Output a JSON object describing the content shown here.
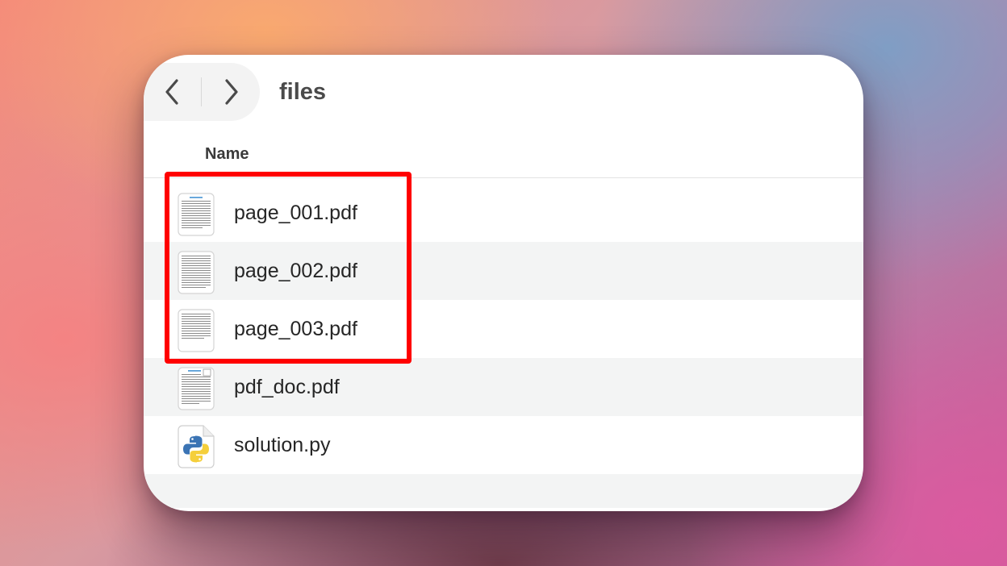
{
  "window": {
    "title": "files"
  },
  "navigation": {
    "back_icon": "chevron-left-icon",
    "forward_icon": "chevron-right-icon"
  },
  "columns": {
    "name_header": "Name"
  },
  "files": [
    {
      "name": "page_001.pdf",
      "icon": "pdf-document-icon"
    },
    {
      "name": "page_002.pdf",
      "icon": "pdf-document-icon"
    },
    {
      "name": "page_003.pdf",
      "icon": "pdf-document-icon"
    },
    {
      "name": "pdf_doc.pdf",
      "icon": "pdf-document-icon"
    },
    {
      "name": "solution.py",
      "icon": "python-file-icon"
    }
  ],
  "annotation": {
    "highlight_color": "#ff0000"
  }
}
